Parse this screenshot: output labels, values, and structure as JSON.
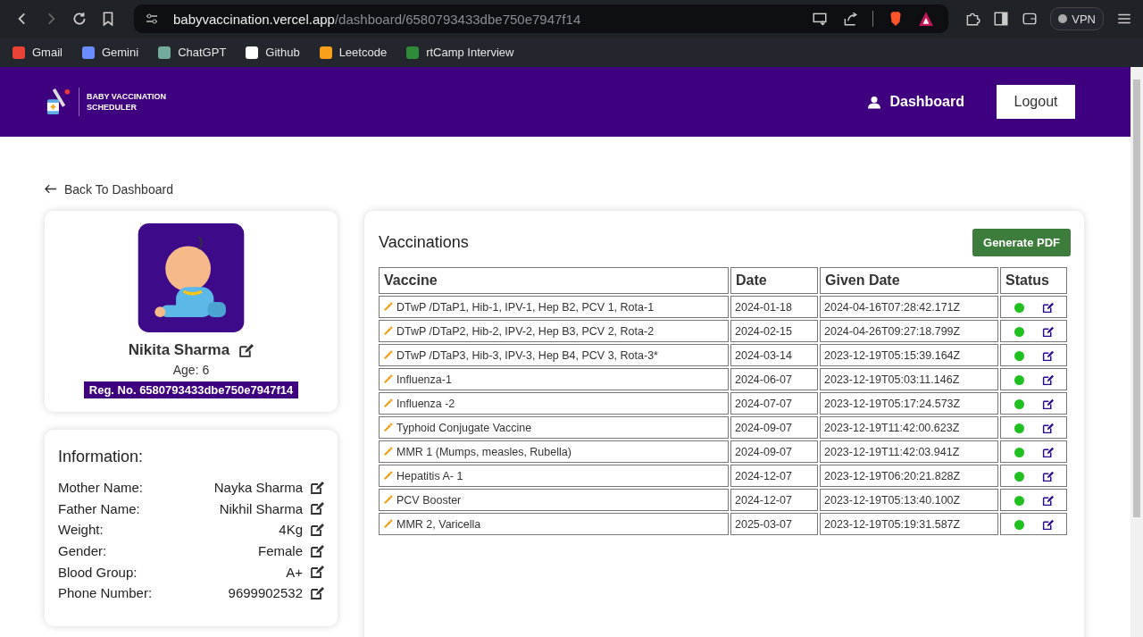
{
  "browser": {
    "url_host": "babyvaccination.vercel.app",
    "url_path": "/dashboard/6580793433dbe750e7947f14",
    "vpn_label": "VPN",
    "bookmarks": [
      {
        "label": "Gmail",
        "kind": "gmail"
      },
      {
        "label": "Gemini",
        "kind": "gemini"
      },
      {
        "label": "ChatGPT",
        "kind": "chatgpt"
      },
      {
        "label": "Github",
        "kind": "github"
      },
      {
        "label": "Leetcode",
        "kind": "leetcode"
      },
      {
        "label": "rtCamp Interview",
        "kind": "rtcamp"
      }
    ]
  },
  "header": {
    "brand_line1": "BABY VACCINATION",
    "brand_line2": "SCHEDULER",
    "nav_label": "Dashboard",
    "logout_label": "Logout"
  },
  "back_link": "Back To Dashboard",
  "profile": {
    "name": "Nikita Sharma",
    "age": "Age: 6",
    "reg_no": "Reg. No. 6580793433dbe750e7947f14"
  },
  "information": {
    "title": "Information:",
    "fields": [
      {
        "label": "Mother Name:",
        "value": "Nayka Sharma"
      },
      {
        "label": "Father Name:",
        "value": "Nikhil Sharma"
      },
      {
        "label": "Weight:",
        "value": "4Kg"
      },
      {
        "label": "Gender:",
        "value": "Female"
      },
      {
        "label": "Blood Group:",
        "value": "A+"
      },
      {
        "label": "Phone Number:",
        "value": "9699902532"
      }
    ]
  },
  "vaccinations": {
    "title": "Vaccinations",
    "pdf_button": "Generate PDF",
    "columns": [
      "Vaccine",
      "Date",
      "Given Date",
      "Status"
    ],
    "rows": [
      {
        "vaccine": "DTwP /DTaP1, Hib-1, IPV-1, Hep B2, PCV 1, Rota-1",
        "date": "2024-01-18",
        "given": "2024-04-16T07:28:42.171Z",
        "done": true
      },
      {
        "vaccine": "DTwP /DTaP2, Hib-2, IPV-2, Hep B3, PCV 2, Rota-2",
        "date": "2024-02-15",
        "given": "2024-04-26T09:27:18.799Z",
        "done": true
      },
      {
        "vaccine": "DTwP /DTaP3, Hib-3, IPV-3, Hep B4, PCV 3, Rota-3*",
        "date": "2024-03-14",
        "given": "2023-12-19T05:15:39.164Z",
        "done": true
      },
      {
        "vaccine": "Influenza-1",
        "date": "2024-06-07",
        "given": "2023-12-19T05:03:11.146Z",
        "done": true
      },
      {
        "vaccine": "Influenza -2",
        "date": "2024-07-07",
        "given": "2023-12-19T05:17:24.573Z",
        "done": true
      },
      {
        "vaccine": "Typhoid Conjugate Vaccine",
        "date": "2024-09-07",
        "given": "2023-12-19T11:42:00.623Z",
        "done": true
      },
      {
        "vaccine": "MMR 1 (Mumps, measles, Rubella)",
        "date": "2024-09-07",
        "given": "2023-12-19T11:42:03.941Z",
        "done": true
      },
      {
        "vaccine": "Hepatitis A- 1",
        "date": "2024-12-07",
        "given": "2023-12-19T06:20:21.828Z",
        "done": true
      },
      {
        "vaccine": "PCV Booster",
        "date": "2024-12-07",
        "given": "2023-12-19T05:13:40.100Z",
        "done": true
      },
      {
        "vaccine": "MMR 2, Varicella",
        "date": "2025-03-07",
        "given": "2023-12-19T05:19:31.587Z",
        "done": true
      }
    ]
  }
}
